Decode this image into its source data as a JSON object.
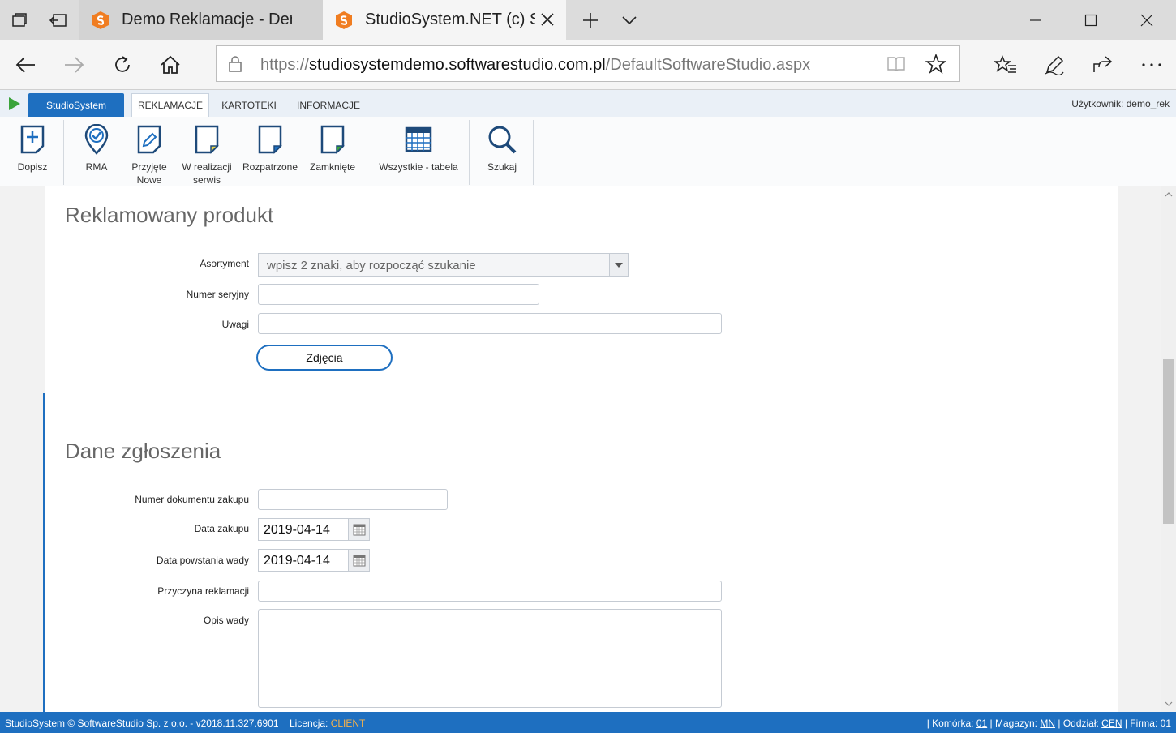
{
  "browser": {
    "tabs": [
      {
        "title": "Demo Reklamacje - Demo c",
        "active": false
      },
      {
        "title": "StudioSystem.NET (c) Sc",
        "active": true
      }
    ],
    "url_prefix": "https://",
    "url_domain": "studiosystemdemo.softwarestudio.com.pl",
    "url_path": "/DefaultSoftwareStudio.aspx"
  },
  "appbar": {
    "start_label": "StudioSystem",
    "tabs": [
      "REKLAMACJE",
      "KARTOTEKI",
      "INFORMACJE"
    ],
    "active_tab": "REKLAMACJE",
    "user": "Użytkownik: demo_rek"
  },
  "ribbon": {
    "dopisz": "Dopisz",
    "rma": "RMA",
    "przyjete_line1": "Przyjęte",
    "przyjete_line2": "Nowe",
    "wrealizacji_line1": "W realizacji",
    "wrealizacji_line2": "serwis",
    "rozpatrzone": "Rozpatrzone",
    "zamkniete": "Zamknięte",
    "wszystkie": "Wszystkie - tabela",
    "szukaj": "Szukaj"
  },
  "product": {
    "title": "Reklamowany produkt",
    "asortyment_label": "Asortyment",
    "asortyment_placeholder": "wpisz 2 znaki, aby rozpocząć szukanie",
    "serial_label": "Numer seryjny",
    "serial_value": "",
    "notes_label": "Uwagi",
    "notes_value": "",
    "photos_button": "Zdjęcia"
  },
  "report": {
    "title": "Dane zgłoszenia",
    "doc_label": "Numer dokumentu zakupu",
    "doc_value": "",
    "purchase_date_label": "Data zakupu",
    "purchase_date": "2019-04-14",
    "defect_date_label": "Data powstania wady",
    "defect_date": "2019-04-14",
    "reason_label": "Przyczyna reklamacji",
    "reason_value": "",
    "description_label": "Opis wady",
    "description_value": ""
  },
  "status": {
    "left": "StudioSystem © SoftwareStudio Sp. z o.o. - v2018.11.327.6901",
    "license_label": "Licencja: ",
    "license_value": "CLIENT",
    "cell_label": "| Komórka: ",
    "cell_value": "01",
    "store_label": " | Magazyn: ",
    "store_value": "MN",
    "branch_label": " | Oddział: ",
    "branch_value": "CEN",
    "company_label": " | Firma: ",
    "company_value": "01"
  },
  "colors": {
    "accent": "#1e6fc0",
    "license": "#f7b24a",
    "brand_logo": "#f07d21"
  }
}
